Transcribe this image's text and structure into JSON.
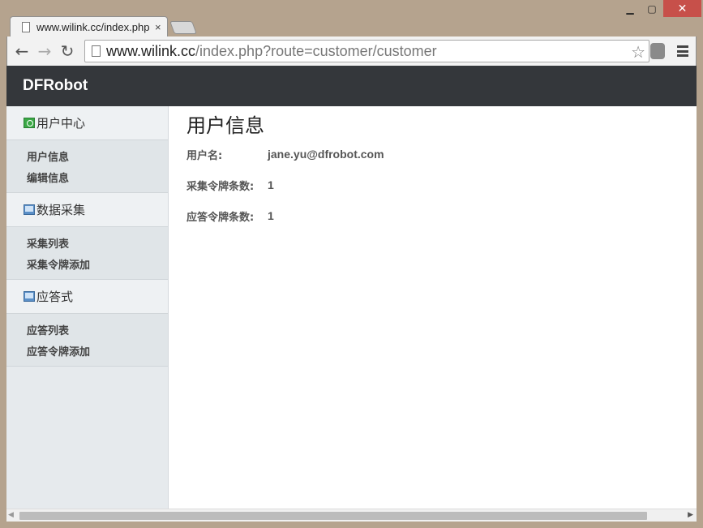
{
  "browser": {
    "tab_title": "www.wilink.cc/index.php",
    "tab_close": "×",
    "url_host": "www.wilink.cc",
    "url_path": "/index.php?route=customer/customer",
    "window_controls": {
      "minimize": "▁",
      "maximize": "▢",
      "close": "✕"
    },
    "nav": {
      "back": "←",
      "forward": "→",
      "reload": "↻",
      "star": "☆"
    }
  },
  "site": {
    "brand": "DFRobot"
  },
  "sidebar": {
    "sections": [
      {
        "title": "用户中心",
        "icon": "user-center-icon",
        "items": [
          "用户信息",
          "编辑信息"
        ]
      },
      {
        "title": "数据采集",
        "icon": "monitor-icon",
        "items": [
          "采集列表",
          "采集令牌添加"
        ]
      },
      {
        "title": "应答式",
        "icon": "monitor-icon",
        "items": [
          "应答列表",
          "应答令牌添加"
        ]
      }
    ]
  },
  "main": {
    "title": "用户信息",
    "fields": [
      {
        "label": "用户名:",
        "value": "jane.yu@dfrobot.com"
      },
      {
        "label": "采集令牌条数:",
        "value": "1"
      },
      {
        "label": "应答令牌条数:",
        "value": "1"
      }
    ]
  },
  "colors": {
    "header_bg": "#34373b",
    "sidebar_bg": "#e6eaed",
    "close_button": "#c7504a"
  }
}
